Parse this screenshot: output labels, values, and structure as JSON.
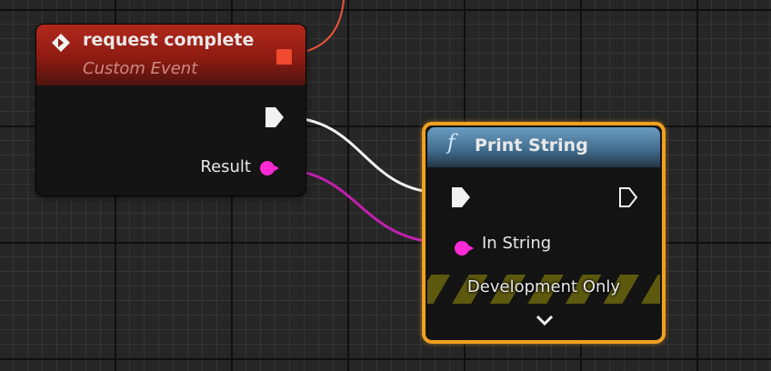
{
  "event_node": {
    "title": "request complete",
    "subtitle": "Custom Event",
    "output_label": "Result"
  },
  "print_node": {
    "icon": "f",
    "title": "Print String",
    "input_label": "In String",
    "band_label": "Development Only"
  },
  "colors": {
    "event_header": "#b3281b",
    "function_header": "#6a9cc0",
    "selection_border": "#f0a020",
    "string_pin": "#ff2ad5",
    "exec_wire": "#ffffff",
    "delegate_pin": "#f0492f"
  }
}
